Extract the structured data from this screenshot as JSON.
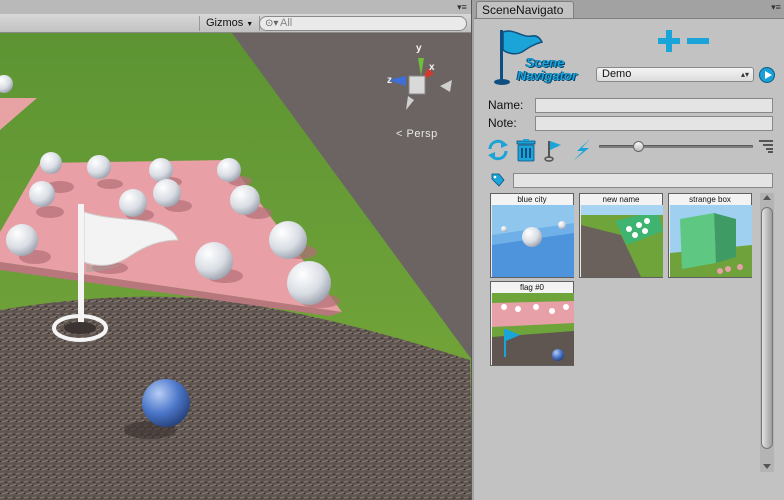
{
  "scene": {
    "gizmos_label": "Gizmos",
    "search_placeholder": "All",
    "persp_label": "Persp",
    "axis_y": "y",
    "axis_x": "x",
    "axis_z": "z",
    "colors": {
      "ground_dirt": "#6b6563",
      "grass": "#6b9b33",
      "pad": "#e7a3a3",
      "ball_white": "#e6e9ee",
      "ball_blue": "#4a74c7"
    }
  },
  "navigator": {
    "tab_title": "SceneNavigato",
    "logo_line1": "Scene",
    "logo_line2": "Navigator",
    "preset_value": "Demo",
    "name_label": "Name:",
    "name_value": "",
    "note_label": "Note:",
    "note_value": "",
    "filter_value": "",
    "zoom_level": 0.24,
    "bookmarks": [
      {
        "caption": "blue city"
      },
      {
        "caption": "new name"
      },
      {
        "caption": "strange box"
      },
      {
        "caption": "flag #0"
      }
    ],
    "icons": {
      "add": "plus-icon",
      "remove": "minus-icon",
      "play": "play-icon",
      "refresh": "refresh-icon",
      "delete": "trash-icon",
      "flag": "flag-icon",
      "lightning": "lightning-icon",
      "view": "list-view-icon",
      "tag": "tag-icon"
    },
    "colors": {
      "accent": "#1a9fd6",
      "panel": "#c2c2c2"
    }
  }
}
